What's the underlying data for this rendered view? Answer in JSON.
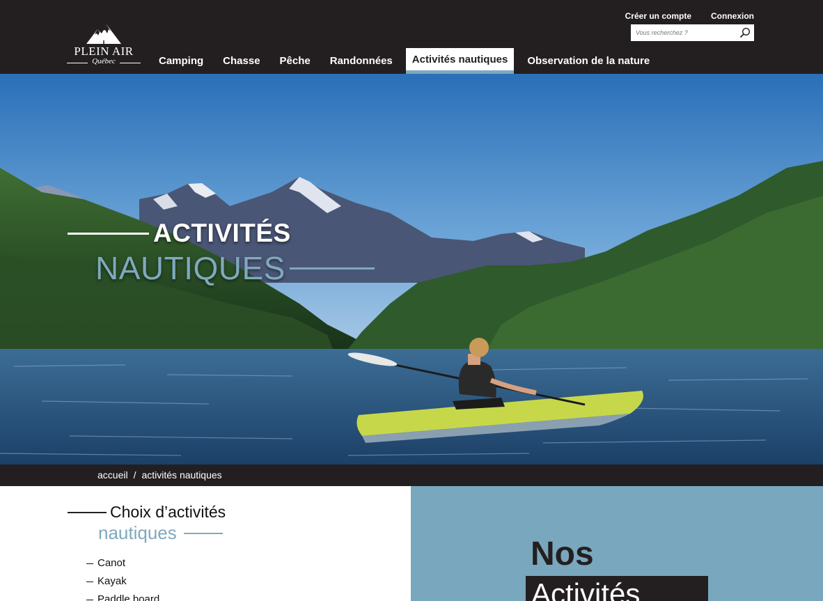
{
  "brand": {
    "name": "PLEIN AIR",
    "subtitle": "Québec"
  },
  "header": {
    "top_links": {
      "create_account": "Créer un compte",
      "login": "Connexion"
    },
    "search": {
      "placeholder": "Vous recherchez ?"
    },
    "nav": [
      {
        "label": "Camping",
        "active": false
      },
      {
        "label": "Chasse",
        "active": false
      },
      {
        "label": "Pêche",
        "active": false
      },
      {
        "label": "Randonnées",
        "active": false
      },
      {
        "label": "Activités nautiques",
        "active": true
      },
      {
        "label": "Observation de la nature",
        "active": false
      }
    ]
  },
  "hero": {
    "title_line1": "ACTIVITÉS",
    "title_line2": "NAUTIQUES"
  },
  "breadcrumb": {
    "home": "accueil",
    "separator": "/",
    "current": "activités nautiques"
  },
  "section": {
    "title_line1": "Choix d’activités",
    "title_line2": "nautiques",
    "activities": [
      "Canot",
      "Kayak",
      "Paddle board"
    ]
  },
  "panel": {
    "heading": "Nos",
    "box_text": "Activités"
  },
  "colors": {
    "dark": "#231f20",
    "accent_blue": "#7fa9bd",
    "panel_blue": "#79a7bd"
  }
}
